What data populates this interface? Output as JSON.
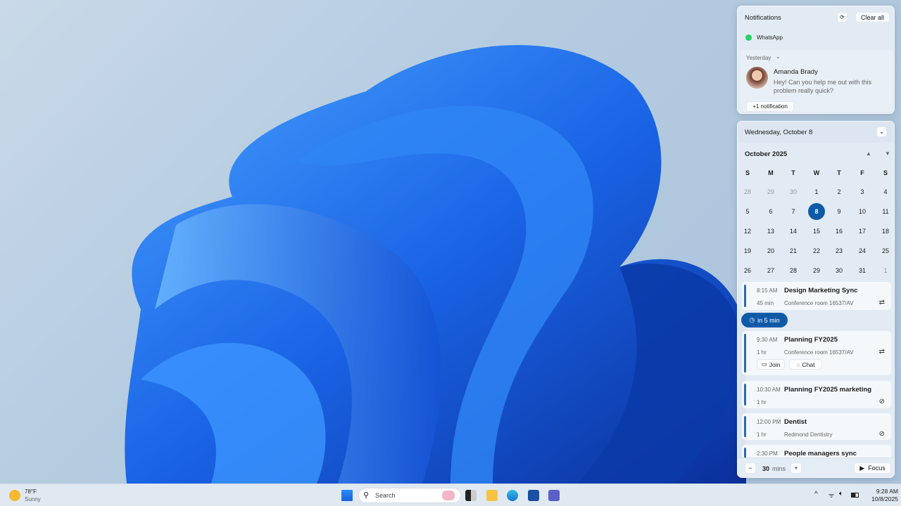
{
  "notifications": {
    "title": "Notifications",
    "clear_all": "Clear all",
    "app": "WhatsApp",
    "group_label": "Yesterday",
    "sender": "Amanda Brady",
    "message": "Hey! Can you help me out with this problem really quick?",
    "more": "+1 notification"
  },
  "calendar": {
    "date_header": "Wednesday, October 8",
    "month": "October 2025",
    "weekdays": [
      "S",
      "M",
      "T",
      "W",
      "T",
      "F",
      "S"
    ],
    "weeks": [
      [
        "28",
        "29",
        "30",
        "1",
        "2",
        "3",
        "4"
      ],
      [
        "5",
        "6",
        "7",
        "8",
        "9",
        "10",
        "11"
      ],
      [
        "12",
        "13",
        "14",
        "15",
        "16",
        "17",
        "18"
      ],
      [
        "19",
        "20",
        "21",
        "22",
        "23",
        "24",
        "25"
      ],
      [
        "26",
        "27",
        "28",
        "29",
        "30",
        "31",
        "1"
      ]
    ],
    "today": "8"
  },
  "events": [
    {
      "time": "8:15 AM",
      "name": "Design Marketing Sync",
      "duration": "45 min",
      "location": "Conference room 16537/AV",
      "icon": "recurring-icon"
    },
    {
      "time": "9:30 AM",
      "name": "Planning FY2025",
      "duration": "1 hr",
      "location": "Conference room 16537/AV",
      "icon": "recurring-icon",
      "join": "Join",
      "chat": "Chat"
    },
    {
      "time": "10:30 AM",
      "name": "Planning FY2025 marketing",
      "duration": "1 hr",
      "location": "",
      "icon": "non-recurring-icon"
    },
    {
      "time": "12:00 PM",
      "name": "Dentist",
      "duration": "1 hr",
      "location": "Redmond Dentistry",
      "icon": "non-recurring-icon"
    },
    {
      "time": "2:30 PM",
      "name": "People managers sync",
      "duration": "",
      "location": ""
    }
  ],
  "upcoming_badge": "in 5 min",
  "focus": {
    "minutes": "30",
    "unit": "mins",
    "button": "Focus"
  },
  "taskbar": {
    "temp": "78°F",
    "condition": "Sunny",
    "search_placeholder": "Search",
    "time": "9:28 AM",
    "date": "10/8/2025"
  },
  "colors": {
    "accent": "#0f5aa8",
    "wallpaper_blue": "#1f6fe8"
  }
}
